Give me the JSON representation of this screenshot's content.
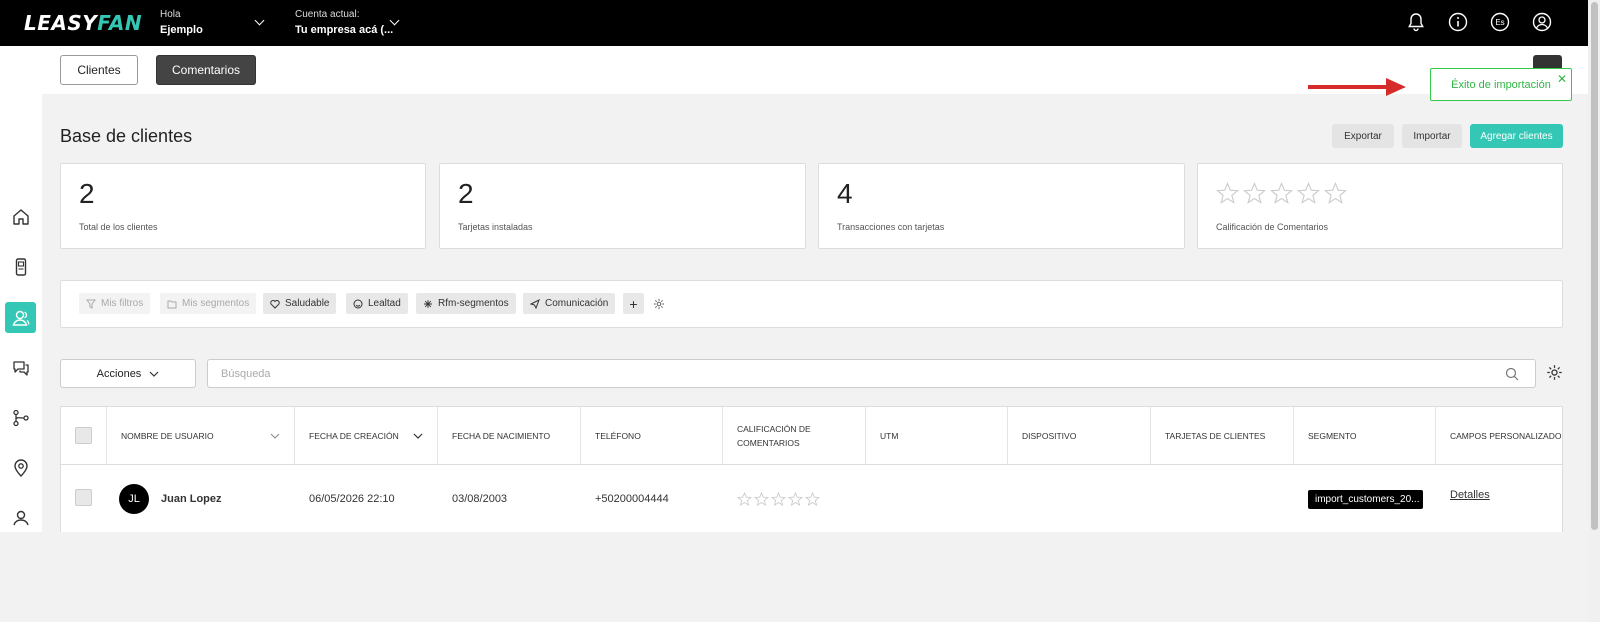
{
  "header": {
    "logo_left": "LEASY",
    "logo_right": "FAN",
    "greeting_label": "Hola",
    "greeting_name": "Ejemplo",
    "account_label": "Cuenta actual:",
    "account_name": "Tu empresa acá (...",
    "language": "Es"
  },
  "tabs": {
    "clients": "Clientes",
    "comments": "Comentarios"
  },
  "toast": {
    "message": "Éxito de importación",
    "close": "✕"
  },
  "page": {
    "title": "Base de clientes",
    "export": "Exportar",
    "import": "Importar",
    "add": "Agregar clientes"
  },
  "stats": [
    {
      "value": "2",
      "label": "Total de los clientes"
    },
    {
      "value": "2",
      "label": "Tarjetas instaladas"
    },
    {
      "value": "4",
      "label": "Transacciones con tarjetas"
    },
    {
      "label": "Calificación de Comentarios",
      "stars": 0
    }
  ],
  "filters": {
    "my_filters": "Mis filtros",
    "my_segments": "Mis segmentos",
    "healthy": "Saludable",
    "loyalty": "Lealtad",
    "rfm": "Rfm-segmentos",
    "communication": "Comunicación",
    "add": "+"
  },
  "toolbar": {
    "actions": "Acciones",
    "search_placeholder": "Búsqueda"
  },
  "table": {
    "headers": {
      "username": "Nombre de usuario",
      "created": "Fecha de creación",
      "birth": "Fecha de nacimiento",
      "phone": "Teléfono",
      "rating_line1": "Calificación de",
      "rating_line2": "comentarios",
      "utm": "UTM",
      "device": "Dispositivo",
      "cards": "Tarjetas de clientes",
      "segment": "Segmento",
      "custom": "Campos personalizados"
    },
    "rows": [
      {
        "initials": "JL",
        "name": "Juan Lopez",
        "created": "06/05/2026 22:10",
        "birth": "03/08/2003",
        "phone": "+50200004444",
        "rating": 0,
        "utm": "",
        "device": "",
        "cards": "",
        "segment": "import_customers_20...",
        "details": "Detalles"
      }
    ]
  },
  "colors": {
    "accent": "#35c7b5",
    "toast_green": "#2fb544",
    "arrow_red": "#d62b2b",
    "topbar": "#000000"
  }
}
